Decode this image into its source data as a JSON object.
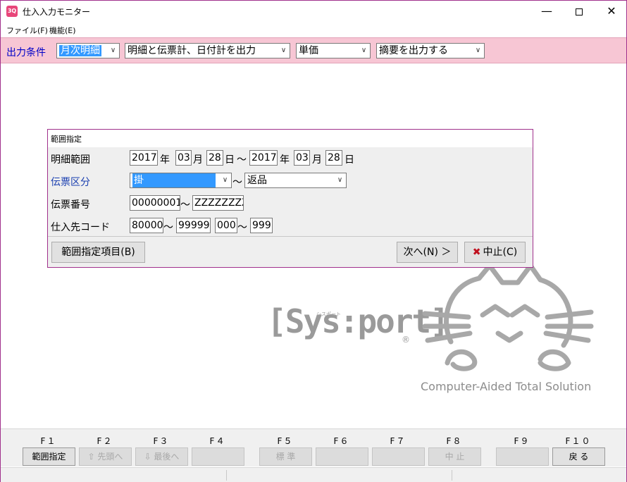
{
  "window": {
    "icon_label": "3Q",
    "title": "仕入入力モニター",
    "minimize": "—",
    "close": "✕"
  },
  "menu": {
    "items": [
      "ファイル(F)",
      "機能(E)"
    ]
  },
  "conditions": {
    "label": "出力条件",
    "combos": [
      {
        "value": "月次明細"
      },
      {
        "value": "明細と伝票計、日付計を出力"
      },
      {
        "value": "単価"
      },
      {
        "value": "摘要を出力する"
      }
    ]
  },
  "dialog": {
    "title": "範囲指定",
    "detail_range": {
      "label": "明細範囲",
      "from_year": "2017",
      "from_month": "03",
      "from_day": "28",
      "to_year": "2017",
      "to_month": "03",
      "to_day": "28",
      "year_unit": "年",
      "month_unit": "月",
      "day_unit": "日",
      "tilde": "～"
    },
    "slip_type": {
      "label": "伝票区分",
      "from": "掛",
      "to": "返品",
      "tilde": "～"
    },
    "slip_number": {
      "label": "伝票番号",
      "from": "00000001",
      "to": "ZZZZZZZZ",
      "tilde": "～"
    },
    "supplier_code": {
      "label": "仕入先コード",
      "from_main": "80000",
      "to_main": "99999",
      "from_sub": "000",
      "to_sub": "999",
      "tilde": "～"
    },
    "buttons": {
      "range_items": "範囲指定項目(B)",
      "next": "次へ(N) ＞",
      "cancel": "中止(C)"
    }
  },
  "logo": {
    "brand": "[Sys:port]",
    "ruby": "シスポート",
    "registered": "®",
    "tagline": "Computer-Aided Total Solution"
  },
  "function_keys": [
    {
      "key": "F１",
      "label": "範囲指定",
      "enabled": true
    },
    {
      "key": "F２",
      "label": "⇧ 先頭へ",
      "enabled": false
    },
    {
      "key": "F３",
      "label": "⇩ 最後へ",
      "enabled": false
    },
    {
      "key": "F４",
      "label": "",
      "enabled": false
    },
    {
      "key": "F５",
      "label": "標 準",
      "enabled": false
    },
    {
      "key": "F６",
      "label": "",
      "enabled": false
    },
    {
      "key": "F７",
      "label": "",
      "enabled": false
    },
    {
      "key": "F８",
      "label": "中 止",
      "enabled": false
    },
    {
      "key": "F９",
      "label": "",
      "enabled": false
    },
    {
      "key": "F１０",
      "label": "戻 る",
      "enabled": true
    }
  ],
  "colors": {
    "window_border": "#a0308c",
    "condition_bar": "#f7c6d4",
    "label_blue": "#0000c8",
    "selection": "#3399ff",
    "cancel_icon": "#c0111f",
    "logo_gray": "#9a9a9a"
  }
}
